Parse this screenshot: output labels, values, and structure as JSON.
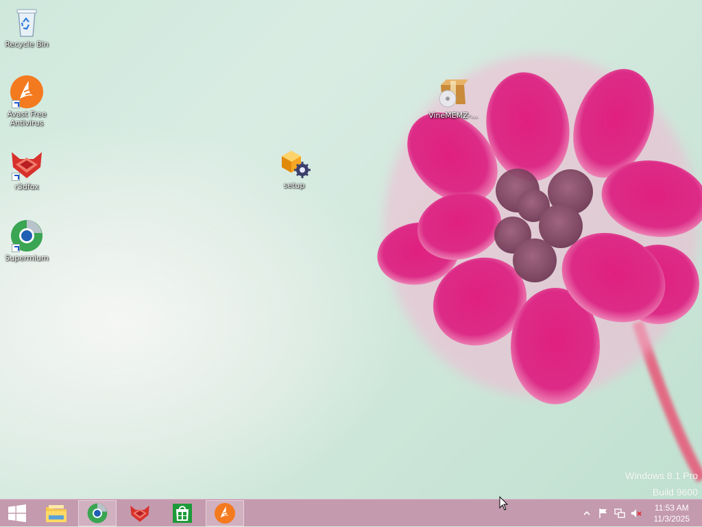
{
  "desktop_icons": [
    {
      "label": "Recycle Bin",
      "icon": "recycle-bin-icon"
    },
    {
      "label": "Avast Free Antivirus",
      "icon": "avast-icon",
      "shortcut": true
    },
    {
      "label": "r3dfox",
      "icon": "r3dfox-icon",
      "shortcut": true
    },
    {
      "label": "Supermium",
      "icon": "supermium-icon",
      "shortcut": true
    },
    {
      "label": "setup",
      "icon": "setup-icon"
    },
    {
      "label": "VineMEMZ-...",
      "icon": "installer-package-icon"
    }
  ],
  "watermark": {
    "line1": "Windows 8.1 Pro",
    "line2": "Build 9600"
  },
  "taskbar": {
    "start": "windows-logo-icon",
    "pinned": [
      "file-explorer-icon",
      "supermium-icon",
      "r3dfox-icon",
      "store-icon",
      "avast-icon"
    ],
    "active": [
      "supermium-icon",
      "avast-icon"
    ],
    "colors": {
      "taskbar": "#c49aae",
      "accent": "#f47a1f"
    }
  },
  "tray": {
    "icons": [
      "show-hidden-icons-icon",
      "action-center-flag-icon",
      "network-icon",
      "volume-muted-icon"
    ],
    "time": "11:53 AM",
    "date": "11/3/2025"
  }
}
